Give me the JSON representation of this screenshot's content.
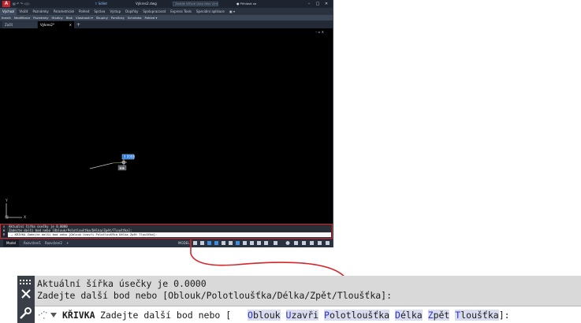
{
  "app": {
    "logo": "A",
    "quick_access": [
      "▤",
      "↶",
      "↷",
      "◁",
      "▷"
    ],
    "share_label": "Sdílet",
    "document_title": "Výkres2.dwg",
    "search_placeholder": "Zadejte klíčové slovo nebo výraz",
    "signin_label": "Přihlásit se",
    "window_controls": [
      "–",
      "□",
      "✕"
    ]
  },
  "ribbon": {
    "tabs": [
      "Výchozí",
      "Vložit",
      "Poznámky",
      "Parametrické",
      "Pohled",
      "Správa",
      "Výstup",
      "Doplňky",
      "Spolupracovat",
      "Express Tools",
      "Speciální aplikace",
      "▣ ▾"
    ],
    "active_tab": 0,
    "panels": [
      "Kreslit",
      "Modifikace",
      "Poznámky",
      "Hladiny",
      "Blok",
      "Vlastnosti ▾",
      "Skupiny",
      "Pomůcky",
      "Schránka",
      "Pohled ▾"
    ]
  },
  "file_tabs": {
    "start": "Začít",
    "drawing": "Výkres2*",
    "add": "+"
  },
  "canvas": {
    "viewport_controls": "– ▫ ✕",
    "dynamic_input_value": "0.0000",
    "cursor_tooltip": "▣▣",
    "ucs_x": "X",
    "ucs_y": "Y"
  },
  "command_small": {
    "line1": "Aktuální šířka úsečky je 0.0000",
    "line2": "Zadejte další bod nebo [Oblouk/Polotloušťka/Délka/Zpět/Tloušťka]:",
    "prompt": "⌄ KŘIVKA Zadejte další bod nebo [Oblouk Uzavři Polotloušťka Délka Zpět Tloušťka]:"
  },
  "statusbar": {
    "layout_tabs": [
      "Model",
      "Rozvržení1",
      "Rozvržení2"
    ],
    "add": "+",
    "model_label": "MODEL"
  },
  "command_zoom": {
    "history": [
      "Aktuální šířka úsečky je 0.0000",
      "Zadejte další bod nebo [Oblouk/Polotloušťka/Délka/Zpět/Tloušťka]:"
    ],
    "command_name": "KŘIVKA",
    "prompt_text": "Zadejte další bod nebo [",
    "options": [
      {
        "key": "O",
        "rest": "blouk"
      },
      {
        "key": "U",
        "rest": "zavři"
      },
      {
        "key": "P",
        "rest": "olotloušťka"
      },
      {
        "key": "D",
        "rest": "élka"
      },
      {
        "key": "Z",
        "rest": "pět"
      },
      {
        "key": "T",
        "rest": "loušťka"
      }
    ],
    "prompt_end": "]:"
  },
  "colors": {
    "highlight_border": "#d6262b",
    "option_key": "#2a32d0",
    "option_bg": "#d9dcee",
    "polyline": "#c0c0c0"
  }
}
